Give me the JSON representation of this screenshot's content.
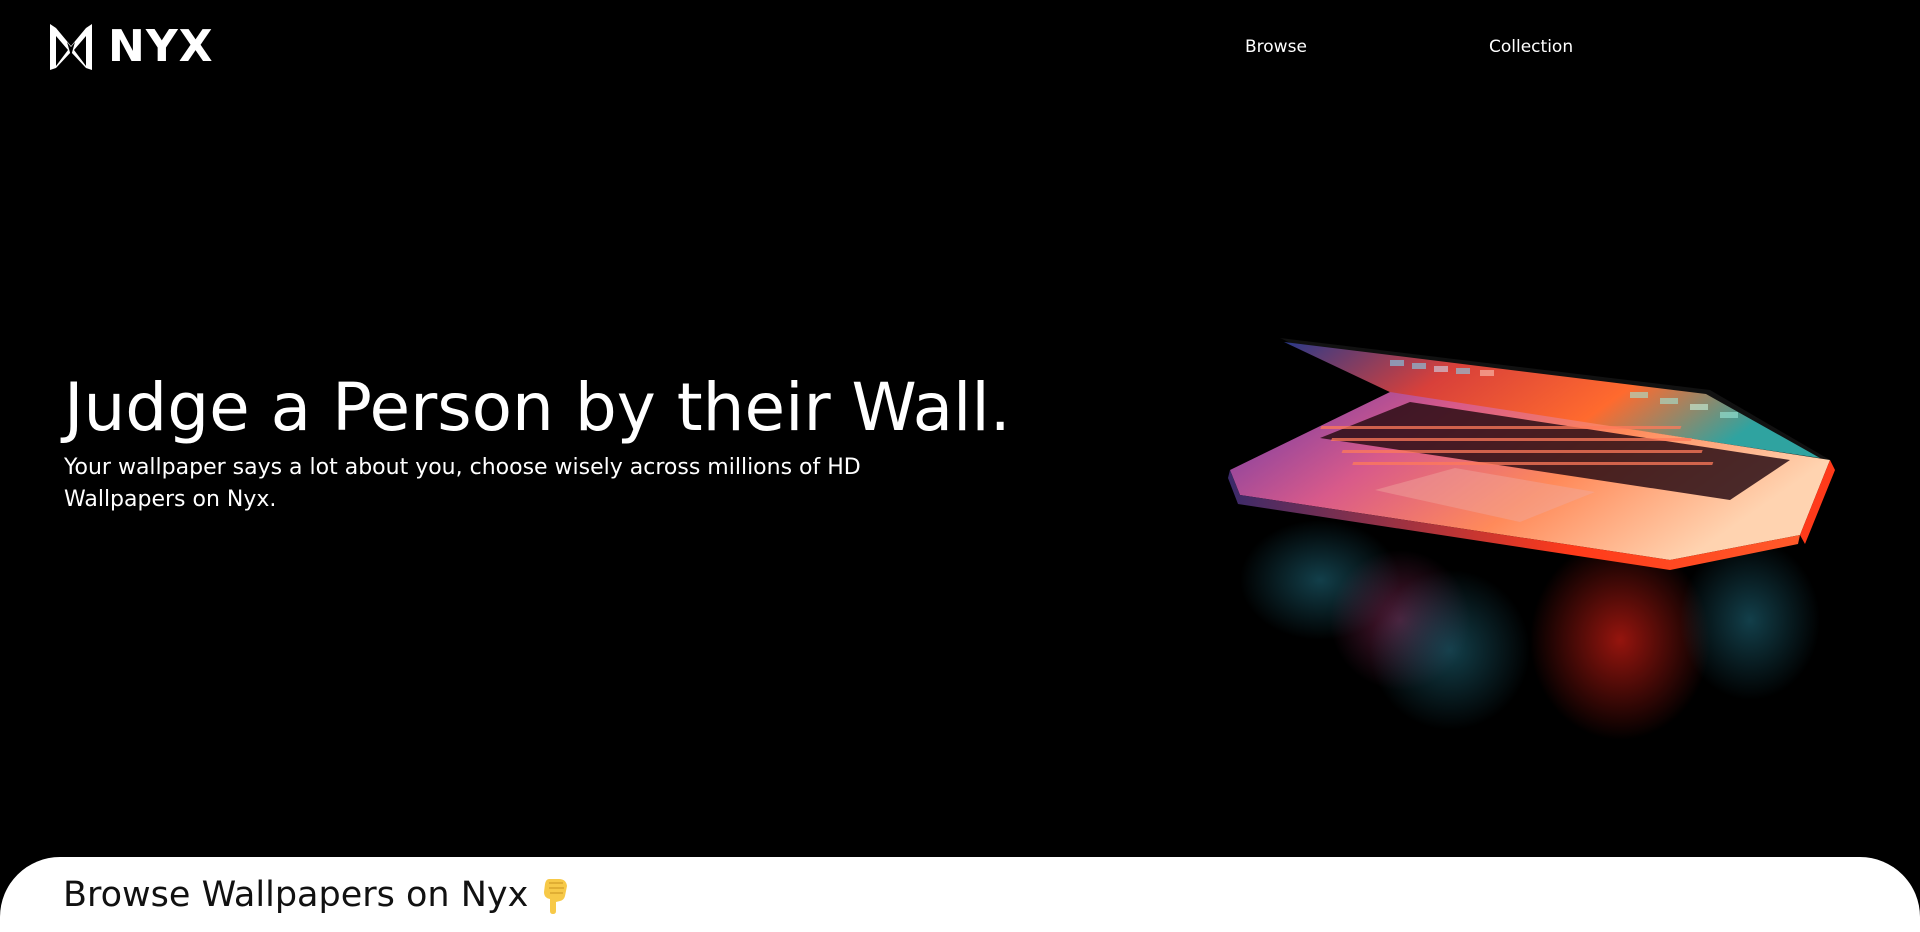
{
  "brand": {
    "name": "NYX",
    "logo_icon": "nyx-logo-icon"
  },
  "nav": {
    "items": [
      {
        "label": "Browse"
      },
      {
        "label": "Collection"
      }
    ]
  },
  "hero": {
    "title": "Judge a Person by their Wall.",
    "subtitle": "Your wallpaper says a lot about you, choose wisely across millions of HD Wallpapers on Nyx.",
    "image": "glowing-laptop-image"
  },
  "browse_section": {
    "title": "Browse Wallpapers on Nyx",
    "icon": "pointing-down-hand-icon"
  },
  "colors": {
    "background": "#000000",
    "text_on_dark": "#ffffff",
    "card_background": "#ffffff",
    "card_text": "#111111",
    "accent_orange": "#ff5a2a",
    "emoji_yellow": "#f7c948"
  }
}
